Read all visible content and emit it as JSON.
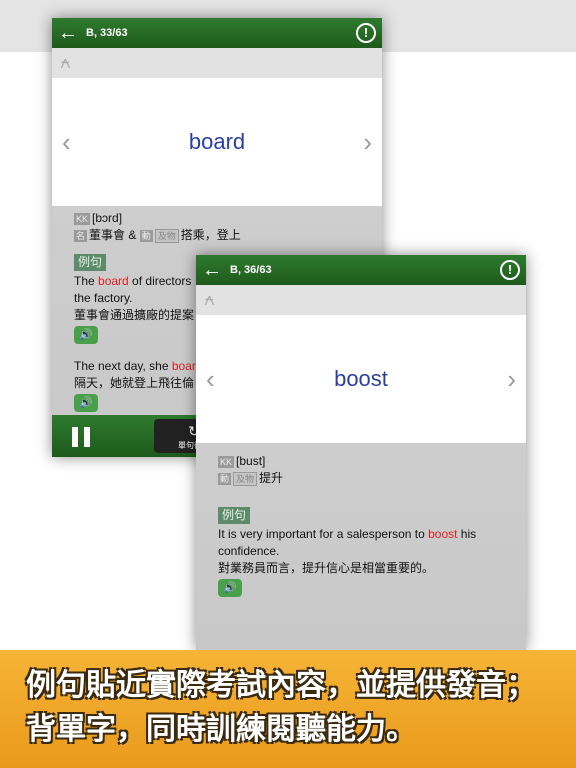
{
  "card1": {
    "position": "B, 33/63",
    "word": "board",
    "phonetic": "[bɔrd]",
    "pos1": "名",
    "def1": "董事會 &",
    "pos2": "動",
    "pos2b": "及物",
    "def2": "搭乘，登上",
    "example_label": "例句",
    "ex1_pre": "The ",
    "ex1_word": "board",
    "ex1_post": " of directors",
    "ex1_line2": "the factory.",
    "ex1_zh": "董事會通過擴廠的提案",
    "ex2_pre": "The next day, she ",
    "ex2_word": "boar",
    "ex2_zh": "隔天，她就登上飛往倫",
    "loop_label": "單句循環"
  },
  "card2": {
    "position": "B, 36/63",
    "word": "boost",
    "phonetic": "[bust]",
    "pos1": "動",
    "pos1b": "及物",
    "def1": "提升",
    "example_label": "例句",
    "ex1_pre": "It is very important for a salesperson to ",
    "ex1_word": "boost",
    "ex1_post": " his confidence.",
    "ex1_zh": "對業務員而言，提升信心是相當重要的。"
  },
  "banner": {
    "line1": "例句貼近實際考試內容，並提供發音；",
    "line2": "背單字，同時訓練閱聽能力。"
  },
  "colors": {
    "header_green": "#1f5a1c",
    "highlight": "#e02020",
    "word": "#2a3fa0",
    "banner": "#f0a62a"
  }
}
